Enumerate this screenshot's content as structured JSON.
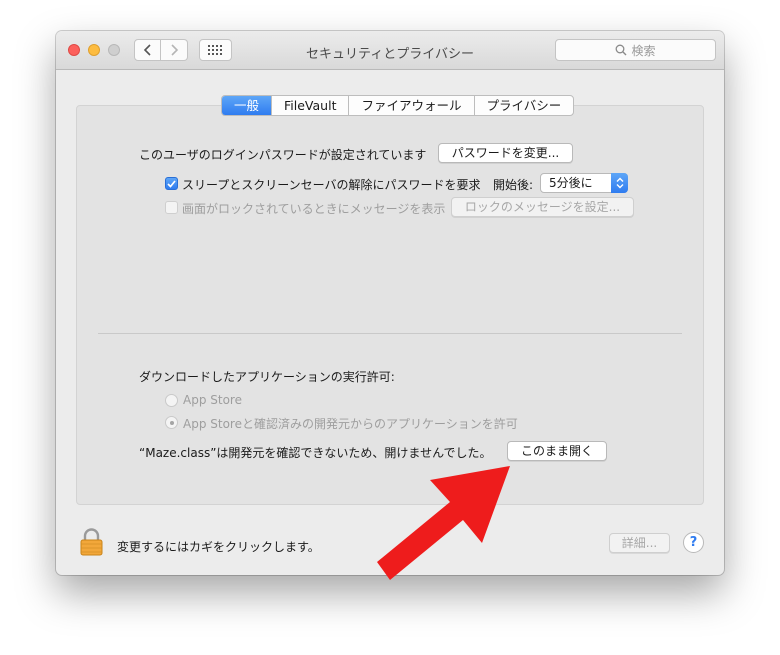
{
  "window": {
    "title": "セキュリティとプライバシー",
    "search_placeholder": "検索"
  },
  "tabs": [
    {
      "label": "一般",
      "active": true
    },
    {
      "label": "FileVault",
      "active": false
    },
    {
      "label": "ファイアウォール",
      "active": false
    },
    {
      "label": "プライバシー",
      "active": false
    }
  ],
  "general": {
    "password_text": "このユーザのログインパスワードが設定されています",
    "change_password_button": "パスワードを変更...",
    "require_password_label": "スリープとスクリーンセーバの解除にパスワードを要求",
    "require_password_checked": true,
    "start_label": "開始後:",
    "start_value": "5分後に",
    "lock_message_label": "画面がロックされているときにメッセージを表示",
    "lock_message_checked": false,
    "set_lock_message_button": "ロックのメッセージを設定..."
  },
  "downloads": {
    "heading": "ダウンロードしたアプリケーションの実行許可:",
    "options": [
      {
        "label": "App Store",
        "selected": false
      },
      {
        "label": "App Storeと確認済みの開発元からのアプリケーションを許可",
        "selected": true
      }
    ],
    "blocked_message": "“Maze.class”は開発元を確認できないため、開けませんでした。",
    "open_anyway_button": "このまま開く"
  },
  "footer": {
    "lock_text": "変更するにはカギをクリックします。",
    "advanced_button": "詳細...",
    "help_button": "?"
  },
  "colors": {
    "accent": "#2f7cf0",
    "annotation_arrow": "#ee1c1c"
  }
}
